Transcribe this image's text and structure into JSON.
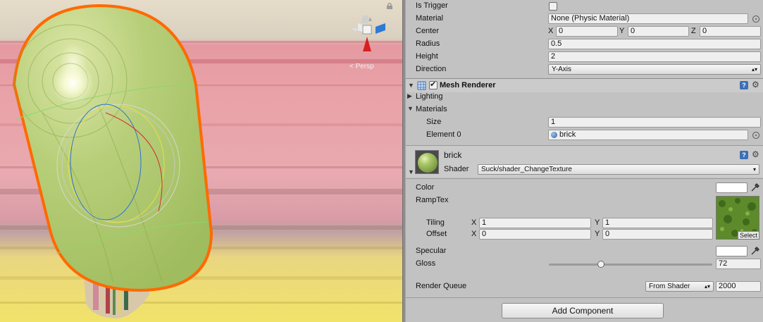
{
  "scene": {
    "view_mode_label": "< Persp"
  },
  "capsule_collider": {
    "is_trigger_label": "Is Trigger",
    "material_label": "Material",
    "material_value": "None (Physic Material)",
    "center_label": "Center",
    "center": {
      "x": "0",
      "y": "0",
      "z": "0"
    },
    "axis_labels": {
      "x": "X",
      "y": "Y",
      "z": "Z"
    },
    "radius_label": "Radius",
    "radius_value": "0.5",
    "height_label": "Height",
    "height_value": "2",
    "direction_label": "Direction",
    "direction_value": "Y-Axis"
  },
  "mesh_renderer": {
    "title": "Mesh Renderer",
    "enabled": true,
    "lighting_label": "Lighting",
    "materials_label": "Materials",
    "size_label": "Size",
    "size_value": "1",
    "element0_label": "Element 0",
    "element0_value": "brick"
  },
  "material": {
    "name": "brick",
    "shader_label": "Shader",
    "shader_value": "Suck/shader_ChangeTexture",
    "color_label": "Color",
    "ramptex_label": "RampTex",
    "tiling_label": "Tiling",
    "offset_label": "Offset",
    "tiling": {
      "x": "1",
      "y": "1"
    },
    "offset": {
      "x": "0",
      "y": "0"
    },
    "select_label": "Select",
    "specular_label": "Specular",
    "gloss_label": "Gloss",
    "gloss_value": "72",
    "gloss_fraction": 0.32,
    "render_queue_label": "Render Queue",
    "render_queue_mode": "From Shader",
    "render_queue_value": "2000"
  },
  "add_component_label": "Add Component",
  "colors": {
    "selection_outline": "#ff6a00",
    "capsule_tint": "#b6d27a",
    "inspector_bg": "#c2c2c2",
    "help_blue": "#3d6fb6"
  }
}
